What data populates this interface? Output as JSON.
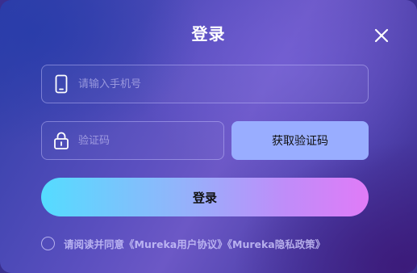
{
  "dialog": {
    "title": "登录"
  },
  "phone_field": {
    "placeholder": "请输入手机号",
    "value": "",
    "icon": "phone-icon"
  },
  "code_field": {
    "placeholder": "验证码",
    "value": "",
    "icon": "lock-icon"
  },
  "get_code_button": {
    "label": "获取验证码"
  },
  "login_button": {
    "label": "登录"
  },
  "agreement": {
    "prefix": "请阅读并同意",
    "user_agreement": "《Mureka用户协议》",
    "privacy_policy": "《Mureka隐私政策》",
    "checked": false
  },
  "colors": {
    "get_code_button_bg": "#99adff",
    "login_gradient_start": "#54dcff",
    "login_gradient_end": "#e07bf7",
    "title_text": "#ffffff"
  }
}
